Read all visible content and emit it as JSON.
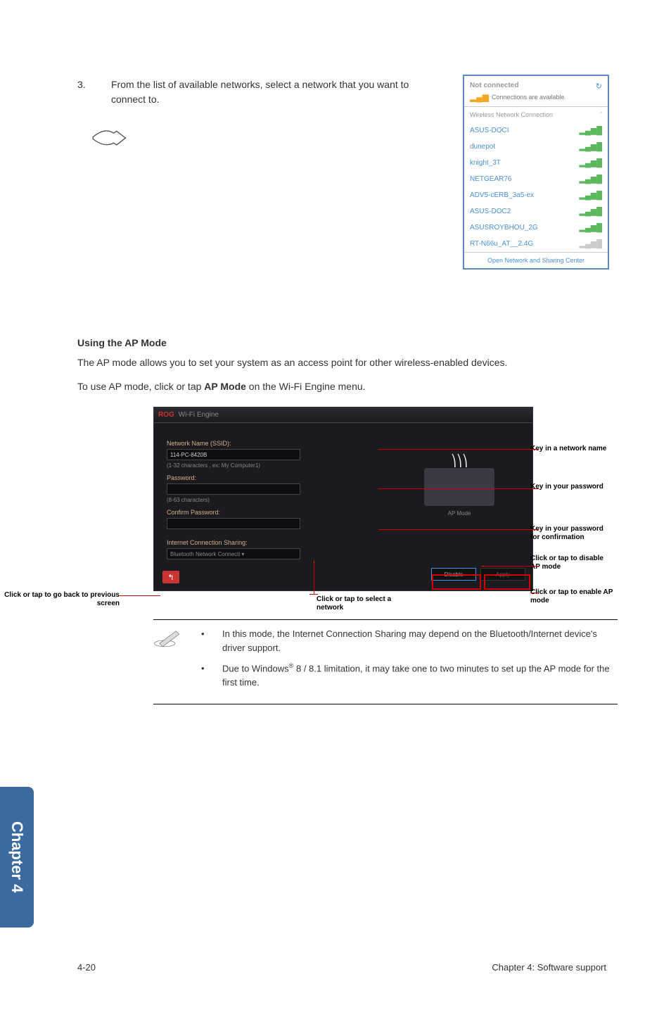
{
  "step": {
    "num": "3.",
    "text": "From the list of available networks, select a network that you want to connect to."
  },
  "wifiPopup": {
    "notConnected": "Not connected",
    "connectionsAvail": "Connections are available",
    "sectionTitle": "Wireless Network Connection",
    "caret": "ˆ",
    "items": [
      {
        "name": "ASUS-DOCI"
      },
      {
        "name": "dunepot"
      },
      {
        "name": "knight_3T"
      },
      {
        "name": "NETGEAR76"
      },
      {
        "name": "ADV5-cERB_3a5-ex"
      },
      {
        "name": "ASUS-DOC2"
      },
      {
        "name": "ASUSROYBHOU_2G"
      },
      {
        "name": "RT-N66u_AT__2.4G"
      }
    ],
    "footer": "Open Network and Sharing Center"
  },
  "apSection": {
    "heading": "Using the AP Mode",
    "para1": "The AP mode allows you to set your system as an access point for other wireless-enabled devices.",
    "para2_a": "To use AP mode, click or tap ",
    "para2_bold": "AP Mode",
    "para2_b": " on the Wi-Fi Engine menu."
  },
  "apWindow": {
    "brand": "ROG",
    "title": "Wi-Fi Engine",
    "netNameLabel": "Network Name (SSID):",
    "netNameVal": "114-PC-8420B",
    "netNameHint": "(1-32 characters , ex: My Computer1)",
    "pwdLabel": "Password:",
    "pwdHint": "(8-63 characters)",
    "confirmLabel": "Confirm Password:",
    "icsLabel": "Internet Connection Sharing:",
    "icsVal": "Bluetooth Network Connecti ▾",
    "apModeText": "AP Mode",
    "disableBtn": "Disable",
    "applyBtn": "Apply",
    "backArrow": "↰"
  },
  "annotations": {
    "netName": "Key in a network name",
    "pwd": "Key in your password",
    "confirm": "Key in your password for confirmation",
    "disable": "Click or tap to disable AP mode",
    "enable": "Click or tap to enable AP mode",
    "selectNet": "Click or tap to select a network",
    "goBack": "Click or tap to go back to previous screen"
  },
  "notes": {
    "n1": "In this mode, the Internet Connection Sharing may depend on the Bluetooth/Internet device's driver support.",
    "n2a": "Due to Windows",
    "n2sup": "®",
    "n2b": " 8 / 8.1 limitation, it may take one to two minutes to set up the AP mode for the first time."
  },
  "sideTab": "Chapter 4",
  "footer": {
    "left": "4-20",
    "right": "Chapter 4: Software support"
  }
}
